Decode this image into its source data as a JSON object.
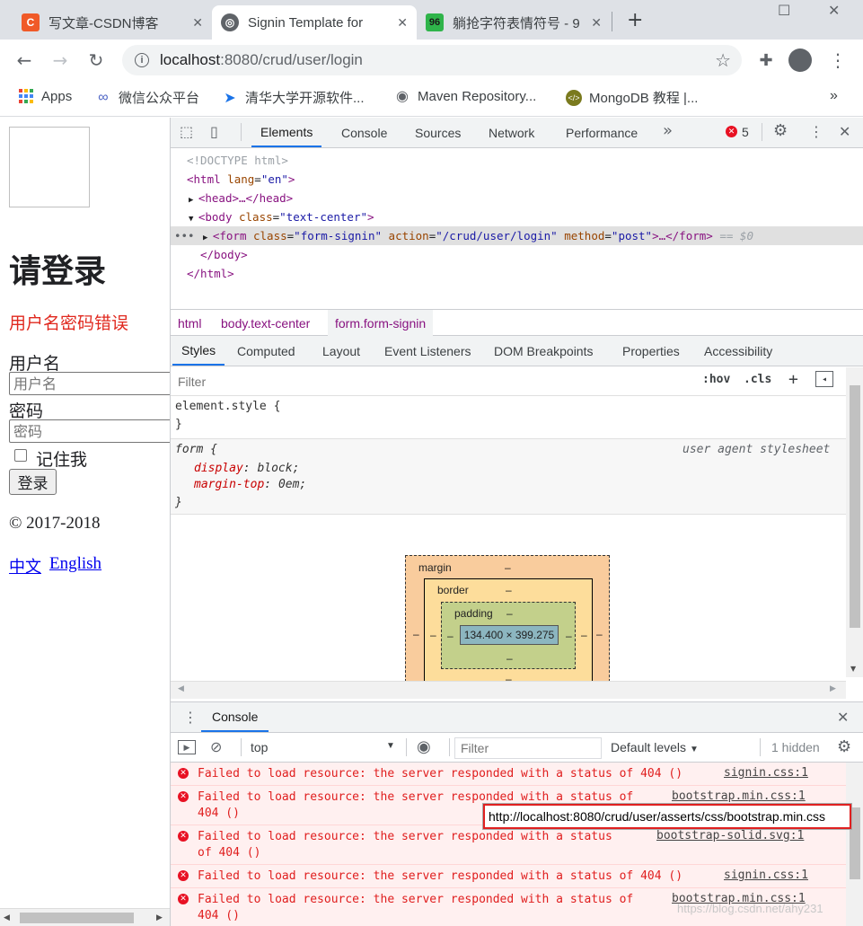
{
  "browser": {
    "tabs": [
      {
        "title": "写文章-CSDN博客",
        "fav": "C",
        "fav_color": "#f05a28"
      },
      {
        "title": "Signin Template for",
        "fav": "",
        "fav_color": "#5f6368"
      },
      {
        "title": "躺抢字符表情符号 - 9",
        "fav": "96",
        "fav_color": "#2fb44a"
      }
    ],
    "new_tab_icon": "+",
    "url_host": "localhost",
    "url_path": ":8080/crud/user/login"
  },
  "bookmarks": [
    {
      "label": "Apps"
    },
    {
      "label": "微信公众平台"
    },
    {
      "label": "清华大学开源软件..."
    },
    {
      "label": "Maven Repository..."
    },
    {
      "label": "MongoDB 教程 |..."
    }
  ],
  "page": {
    "heading": "请登录",
    "error": "用户名密码错误",
    "username_label": "用户名",
    "username_placeholder": "用户名",
    "password_label": "密码",
    "password_placeholder": "密码",
    "remember_label": "记住我",
    "login_button": "登录",
    "copyright": "© 2017-2018",
    "lang_zh": "中文",
    "lang_en": "English"
  },
  "devtools": {
    "tabs": [
      "Elements",
      "Console",
      "Sources",
      "Network",
      "Performance"
    ],
    "error_count": "5",
    "dom": {
      "doctype": "<!DOCTYPE html>",
      "html_open": "<html",
      "html_lang_attr": " lang",
      "html_lang_val": "\"en\"",
      "html_close_br": ">",
      "head": "<head>…</head>",
      "body_open": "<body",
      "body_class_attr": " class",
      "body_class_val": "\"text-center\"",
      "form_open": "<form",
      "form_class_attr": " class",
      "form_class_val": "\"form-signin\"",
      "form_action_attr": " action",
      "form_action_val": "\"/crud/user/login\"",
      "form_method_attr": " method",
      "form_method_val": "\"post\"",
      "form_rest": ">…</form>",
      "form_suffix": " == $0",
      "body_close": "</body>",
      "html_close": "</html>"
    },
    "breadcrumbs": [
      "html",
      "body.text-center",
      "form.form-signin"
    ],
    "style_tabs": [
      "Styles",
      "Computed",
      "Layout",
      "Event Listeners",
      "DOM Breakpoints",
      "Properties",
      "Accessibility"
    ],
    "filter_placeholder": "Filter",
    "hov": ":hov",
    "cls": ".cls",
    "element_style": "element.style {",
    "close_brace": "}",
    "form_rule": {
      "selector": "form {",
      "source": "user agent stylesheet",
      "props": [
        {
          "name": "display",
          "value": "block"
        },
        {
          "name": "margin-top",
          "value": "0em"
        }
      ]
    },
    "box_model": {
      "margin": "margin",
      "border": "border",
      "padding": "padding",
      "content": "134.400 × 399.275",
      "dash": "–"
    },
    "console": {
      "title": "Console",
      "context": "top",
      "filter_placeholder": "Filter",
      "levels": "Default levels",
      "hidden": "1 hidden",
      "messages": [
        {
          "text": "Failed to load resource: the server responded with a status of 404 ()",
          "source": "signin.css:1"
        },
        {
          "text": "Failed to load resource: the server responded with a status of\n404 ()",
          "source": "bootstrap.min.css:1"
        },
        {
          "text": "Failed to load resource: the server responded with a status\nof 404 ()",
          "source": "bootstrap-solid.svg:1"
        },
        {
          "text": "Failed to load resource: the server responded with a status of 404 ()",
          "source": "signin.css:1"
        },
        {
          "text": "Failed to load resource: the server responded with a status of\n404 ()",
          "source": "bootstrap.min.css:1"
        }
      ],
      "tooltip": "http://localhost:8080/crud/user/asserts/css/bootstrap.min.css"
    }
  },
  "watermark": "https://blog.csdn.net/ahy231"
}
